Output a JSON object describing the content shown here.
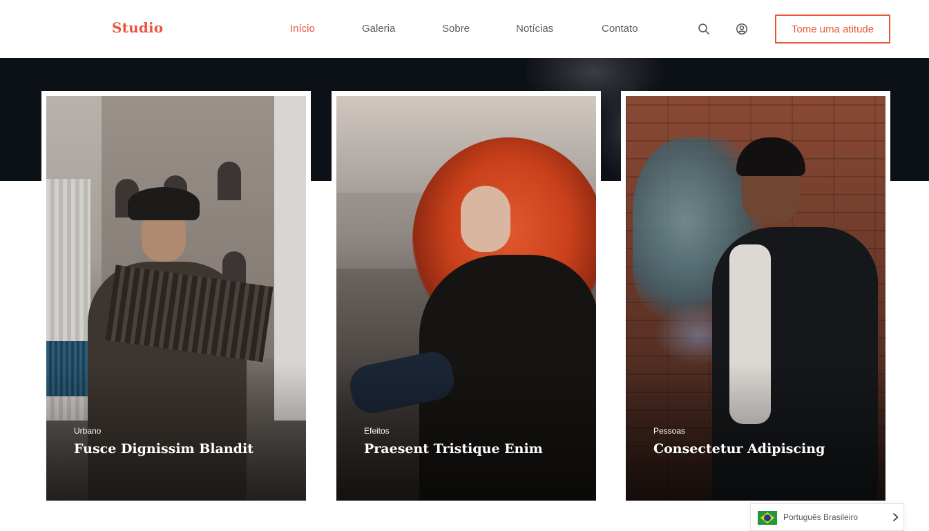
{
  "header": {
    "logo": "Studio",
    "nav": [
      {
        "label": "Início",
        "active": true
      },
      {
        "label": "Galeria",
        "active": false
      },
      {
        "label": "Sobre",
        "active": false
      },
      {
        "label": "Notícias",
        "active": false
      },
      {
        "label": "Contato",
        "active": false
      }
    ],
    "icons": [
      "search-icon",
      "user-icon"
    ],
    "cta": "Tome uma atitude"
  },
  "cards": [
    {
      "category": "Urbano",
      "title": "Fusce Dignissim Blandit"
    },
    {
      "category": "Efeitos",
      "title": "Praesent Tristique Enim"
    },
    {
      "category": "Pessoas",
      "title": "Consectetur Adipiscing"
    }
  ],
  "language": {
    "label": "Português Brasileiro",
    "flag": "brazil-flag-icon"
  },
  "colors": {
    "accent": "#e8553a",
    "hero_dark": "#0c1117",
    "text_muted": "#5a5a5a"
  }
}
